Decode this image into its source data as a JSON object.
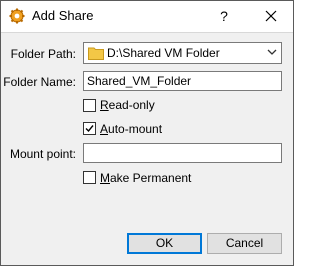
{
  "window": {
    "title": "Add Share",
    "help_glyph": "?",
    "app_icon": "virtualbox-gear-icon",
    "close_icon": "close-icon"
  },
  "form": {
    "folder_path": {
      "label": "Folder Path:",
      "value": "D:\\Shared VM Folder",
      "icon": "folder-icon"
    },
    "folder_name": {
      "label": "Folder Name:",
      "value": "Shared_VM_Folder"
    },
    "read_only": {
      "label": "Read-only",
      "checked": false
    },
    "auto_mount": {
      "label": "Auto-mount",
      "checked": true
    },
    "mount_point": {
      "label": "Mount point:",
      "value": ""
    },
    "make_permanent": {
      "label": "Make Permanent",
      "checked": false
    }
  },
  "buttons": {
    "ok": "OK",
    "cancel": "Cancel"
  },
  "colors": {
    "accent": "#0078d7",
    "folder": "#f3c746",
    "gear": "#f0a020"
  }
}
